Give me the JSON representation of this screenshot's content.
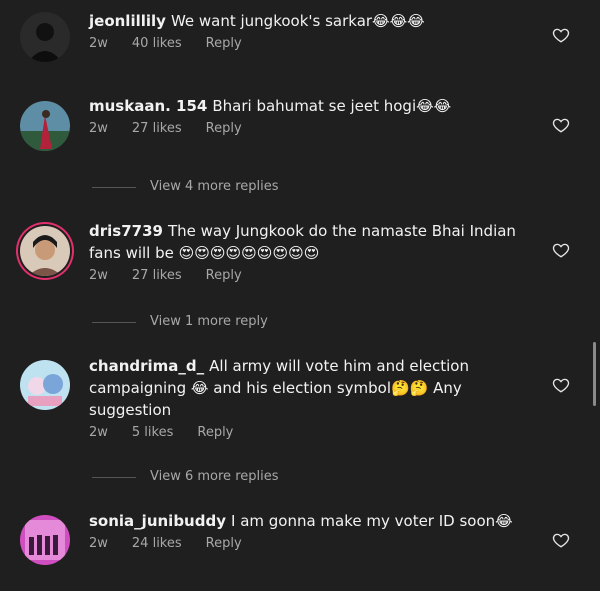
{
  "comments": [
    {
      "user": "jeonlillily",
      "text": "We want jungkook's sarkar😂😂😂",
      "time": "2w",
      "likes": "40 likes",
      "reply": "Reply"
    },
    {
      "user": "muskaan. 154",
      "text": "Bhari bahumat se jeet hogi😂😂",
      "time": "2w",
      "likes": "27 likes",
      "reply": "Reply",
      "more_replies": "View 4 more replies"
    },
    {
      "user": "dris7739",
      "text": "The way Jungkook do the namaste Bhai Indian fans will be 😍😍😍😍😍😍😍😍😍",
      "time": "2w",
      "likes": "27 likes",
      "reply": "Reply",
      "more_replies": "View 1 more reply"
    },
    {
      "user": "chandrima_d_",
      "text": "All army will vote him and election campaigning 😂 and his election symbol🤔🤔 Any suggestion",
      "time": "2w",
      "likes": "5 likes",
      "reply": "Reply",
      "more_replies": "View 6 more replies"
    },
    {
      "user": "sonia_junibuddy",
      "text": "I am gonna make my voter ID soon😂",
      "time": "2w",
      "likes": "24 likes",
      "reply": "Reply"
    }
  ],
  "icons": {
    "like": "heart-outline-icon"
  },
  "colors": {
    "background": "#1f1f1f",
    "muted": "#a8a8a8",
    "story_ring": "#e1306c"
  }
}
